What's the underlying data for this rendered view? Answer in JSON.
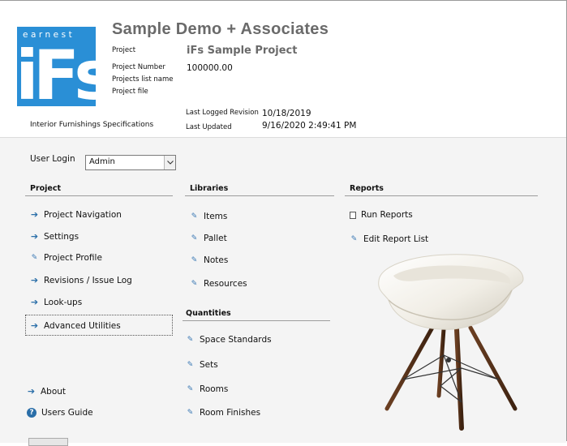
{
  "header": {
    "company": "Sample Demo + Associates",
    "logo_word": "earnest",
    "logo_letters": "iFs",
    "labels": {
      "project": "Project",
      "project_number": "Project Number",
      "projects_list_name": "Projects list name",
      "project_file": "Project file",
      "last_logged_revision": "Last Logged Revision",
      "last_updated": "Last Updated"
    },
    "project_name": "iFs Sample Project",
    "project_number": "100000.00",
    "last_logged_revision": "10/18/2019",
    "last_updated": "9/16/2020 2:49:41 PM",
    "tagline": "Interior Furnishings Specifications"
  },
  "login": {
    "label": "User Login",
    "value": "Admin"
  },
  "project": {
    "heading": "Project",
    "items": [
      {
        "label": "Project Navigation",
        "icon": "arrow-right-icon"
      },
      {
        "label": "Settings",
        "icon": "arrow-right-icon"
      },
      {
        "label": "Project Profile",
        "icon": "pencil-icon"
      },
      {
        "label": "Revisions / Issue Log",
        "icon": "arrow-right-icon"
      },
      {
        "label": "Look-ups",
        "icon": "arrow-right-icon"
      },
      {
        "label": "Advanced Utilities",
        "icon": "arrow-right-icon"
      }
    ],
    "about": "About",
    "users_guide": "Users Guide"
  },
  "libraries": {
    "heading": "Libraries",
    "items": [
      "Items",
      "Pallet",
      "Notes",
      "Resources"
    ]
  },
  "quantities": {
    "heading": "Quantities",
    "items": [
      "Space Standards",
      "Sets",
      "Rooms",
      "Room Finishes"
    ]
  },
  "reports": {
    "heading": "Reports",
    "items": [
      "Run Reports",
      "Edit Report List"
    ]
  },
  "colors": {
    "logo_blue": "#2a8fd6",
    "link_blue": "#2a6ea8",
    "panel_bg": "#f4f4f4"
  }
}
